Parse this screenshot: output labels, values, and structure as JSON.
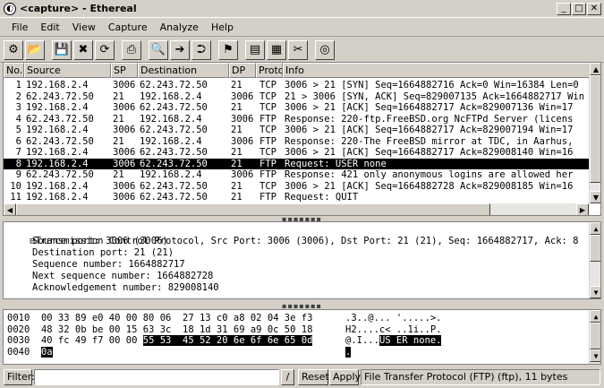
{
  "window": {
    "title": "<capture> - Ethereal",
    "minimize_glyph": "_",
    "maximize_glyph": "□",
    "close_glyph": "✕"
  },
  "menu": [
    "File",
    "Edit",
    "View",
    "Capture",
    "Analyze",
    "Help"
  ],
  "toolbar": [
    {
      "name": "interfaces-icon",
      "glyph": "⚙"
    },
    {
      "name": "open-icon",
      "glyph": "📂"
    },
    {
      "name": "save-icon",
      "glyph": "💾"
    },
    {
      "name": "close-file-icon",
      "glyph": "✖"
    },
    {
      "name": "reload-icon",
      "glyph": "⟳"
    },
    {
      "name": "print-icon",
      "glyph": "⎙"
    },
    {
      "name": "find-icon",
      "glyph": "🔍"
    },
    {
      "name": "go-next-icon",
      "glyph": "➔"
    },
    {
      "name": "go-to-icon",
      "glyph": "⮊"
    },
    {
      "name": "capture-filter-icon",
      "glyph": "⚑"
    },
    {
      "name": "display-filter-icon",
      "glyph": "▤"
    },
    {
      "name": "coloring-icon",
      "glyph": "▦"
    },
    {
      "name": "preferences-icon",
      "glyph": "✂"
    },
    {
      "name": "help-icon",
      "glyph": "◎"
    }
  ],
  "packet_list": {
    "columns": [
      "No.",
      "Source",
      "SP",
      "Destination",
      "DP",
      "Protocol",
      "Info"
    ],
    "rows": [
      {
        "no": "1",
        "src": "192.168.2.4",
        "sp": "3006",
        "dst": "62.243.72.50",
        "dp": "21",
        "proto": "TCP",
        "info": "3006 > 21 [SYN] Seq=1664882716 Ack=0 Win=16384 Len=0"
      },
      {
        "no": "2",
        "src": "62.243.72.50",
        "sp": "21",
        "dst": "192.168.2.4",
        "dp": "3006",
        "proto": "TCP",
        "info": "21 > 3006 [SYN, ACK] Seq=829007135 Ack=1664882717 Win"
      },
      {
        "no": "3",
        "src": "192.168.2.4",
        "sp": "3006",
        "dst": "62.243.72.50",
        "dp": "21",
        "proto": "TCP",
        "info": "3006 > 21 [ACK] Seq=1664882717 Ack=829007136 Win=17"
      },
      {
        "no": "4",
        "src": "62.243.72.50",
        "sp": "21",
        "dst": "192.168.2.4",
        "dp": "3006",
        "proto": "FTP",
        "info": "Response: 220-ftp.FreeBSD.org NcFTPd Server (licens"
      },
      {
        "no": "5",
        "src": "192.168.2.4",
        "sp": "3006",
        "dst": "62.243.72.50",
        "dp": "21",
        "proto": "TCP",
        "info": "3006 > 21 [ACK] Seq=1664882717 Ack=829007194 Win=17"
      },
      {
        "no": "6",
        "src": "62.243.72.50",
        "sp": "21",
        "dst": "192.168.2.4",
        "dp": "3006",
        "proto": "FTP",
        "info": "Response: 220-The FreeBSD mirror at TDC, in Aarhus,"
      },
      {
        "no": "7",
        "src": "192.168.2.4",
        "sp": "3006",
        "dst": "62.243.72.50",
        "dp": "21",
        "proto": "TCP",
        "info": "3006 > 21 [ACK] Seq=1664882717 Ack=829008140 Win=16"
      },
      {
        "no": "8",
        "src": "192.168.2.4",
        "sp": "3006",
        "dst": "62.243.72.50",
        "dp": "21",
        "proto": "FTP",
        "info": "Request: USER none",
        "selected": true
      },
      {
        "no": "9",
        "src": "62.243.72.50",
        "sp": "21",
        "dst": "192.168.2.4",
        "dp": "3006",
        "proto": "FTP",
        "info": "Response: 421 only anonymous logins are allowed her"
      },
      {
        "no": "10",
        "src": "192.168.2.4",
        "sp": "3006",
        "dst": "62.243.72.50",
        "dp": "21",
        "proto": "TCP",
        "info": "3006 > 21 [ACK] Seq=1664882728 Ack=829008185 Win=16"
      },
      {
        "no": "11",
        "src": "192.168.2.4",
        "sp": "3006",
        "dst": "62.243.72.50",
        "dp": "21",
        "proto": "FTP",
        "info": "Request: QUIT"
      }
    ]
  },
  "pane_grip": "▪▪▪▪▪▪▪",
  "details": {
    "expander": "⊟",
    "header": "Transmission Control Protocol, Src Port: 3006 (3006), Dst Port: 21 (21), Seq: 1664882717, Ack: 8",
    "fields": [
      "Source port: 3006 (3006)",
      "Destination port: 21 (21)",
      "Sequence number: 1664882717",
      "Next sequence number: 1664882728",
      "Acknowledgement number: 829008140"
    ]
  },
  "hex": {
    "lines": [
      {
        "offset": "0010",
        "bytes": "00 33 89 e0 40 00 80 06  27 13 c0 a8 02 04 3e f3",
        "bytes_hl": "",
        "ascii": ".3..@... '.....>.",
        "ascii_hl": ""
      },
      {
        "offset": "0020",
        "bytes": "48 32 0b be 00 15 63 3c  18 1d 31 69 a9 0c 50 18",
        "bytes_hl": "",
        "ascii": "H2....c< ..1i..P.",
        "ascii_hl": ""
      },
      {
        "offset": "0030",
        "bytes": "40 fc 49 f7 00 00 ",
        "bytes_hl": "55 53  45 52 20 6e 6f 6e 65 0d",
        "ascii": "@.I...",
        "ascii_hl": "US ER none."
      },
      {
        "offset": "0040",
        "bytes": "",
        "bytes_hl": "0a",
        "ascii": "",
        "ascii_hl": "."
      }
    ]
  },
  "filter": {
    "label": "Filter:",
    "value": "",
    "expr_button": "/",
    "reset": "Reset",
    "apply": "Apply",
    "status": "File Transfer Protocol (FTP) (ftp), 11 bytes"
  }
}
